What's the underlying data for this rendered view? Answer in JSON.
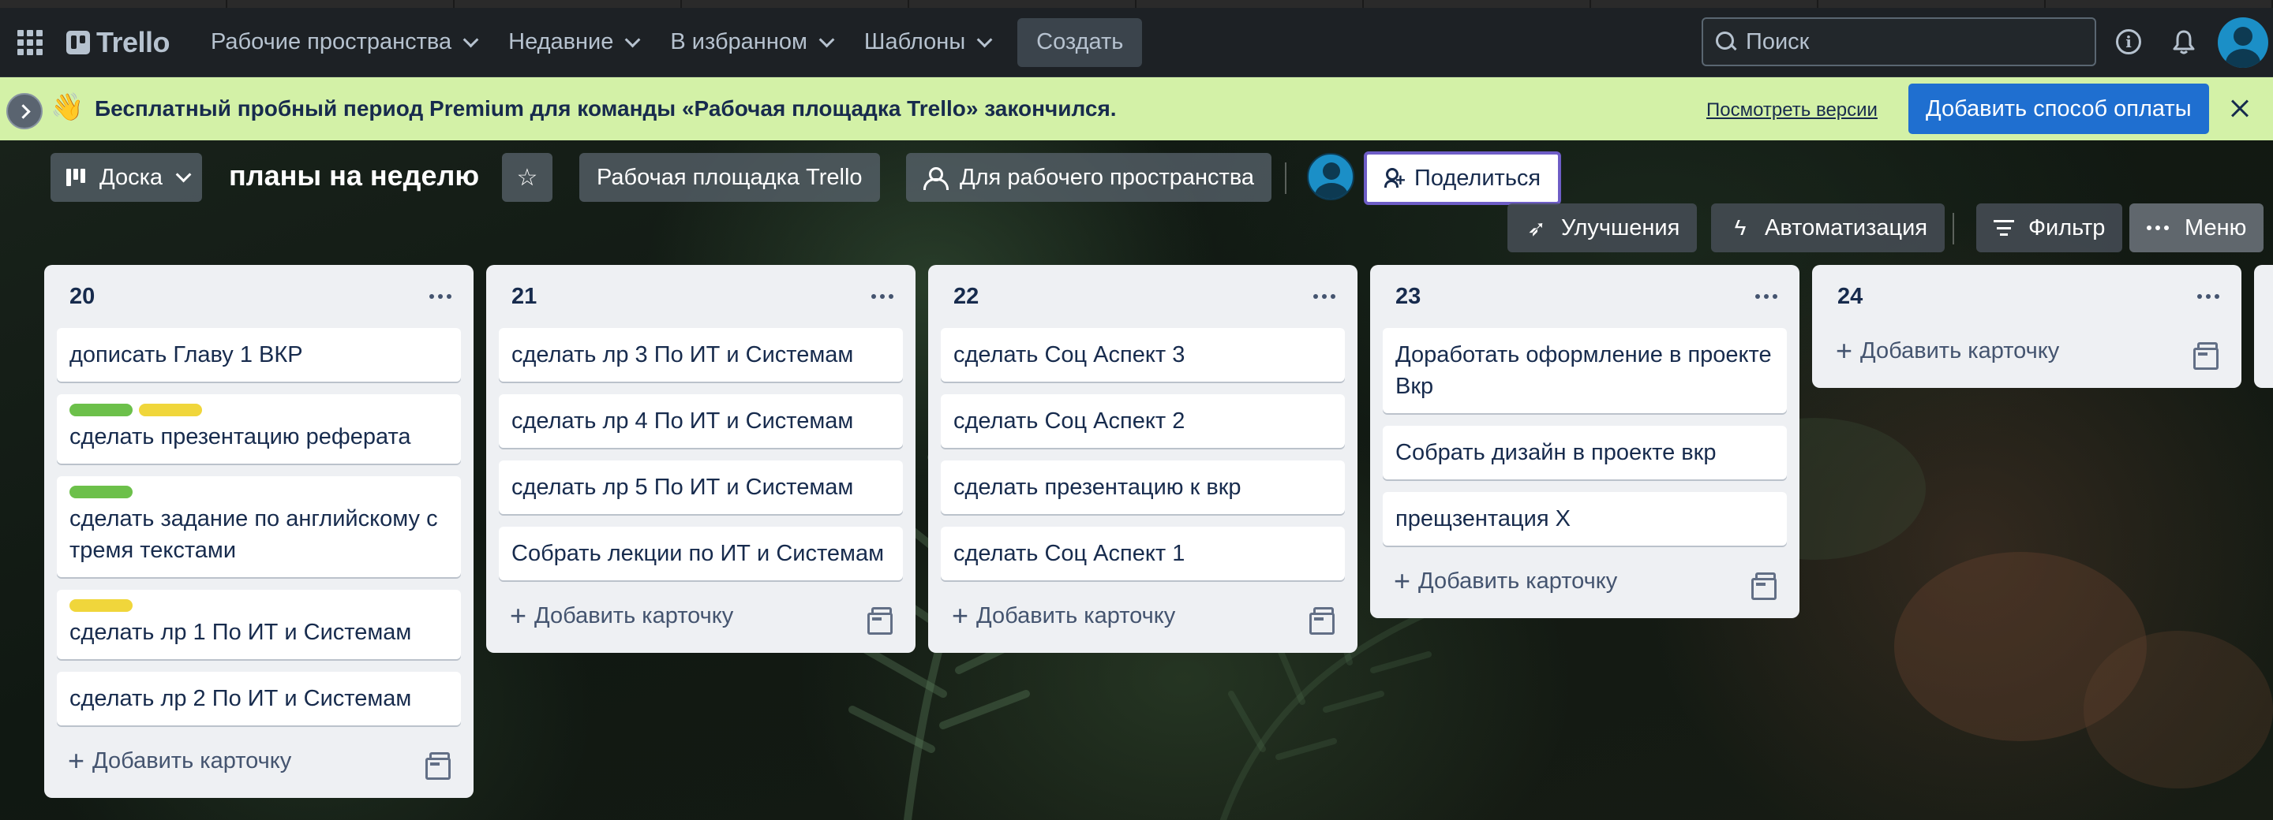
{
  "header": {
    "logo_text": "Trello",
    "nav": [
      {
        "label": "Рабочие пространства"
      },
      {
        "label": "Недавние"
      },
      {
        "label": "В избранном"
      },
      {
        "label": "Шаблоны"
      }
    ],
    "create_label": "Создать",
    "search_placeholder": "Поиск",
    "icons": [
      "apps-icon",
      "info-icon",
      "bell-icon",
      "avatar"
    ]
  },
  "banner": {
    "emoji": "👋",
    "text": "Бесплатный пробный период Premium для команды «Рабочая площадка Trello» закончился.",
    "link": "Посмотреть версии",
    "pay_button": "Добавить способ оплаты",
    "background": "#d3f1a7",
    "accent": "#1f6fd0"
  },
  "board": {
    "view_label": "Доска",
    "title": "планы на неделю",
    "workspace_label": "Рабочая площадка Trello",
    "visibility_label": "Для рабочего пространства",
    "share_label": "Поделиться",
    "upgrades_label": "Улучшения",
    "automation_label": "Автоматизация",
    "filter_label": "Фильтр",
    "menu_label": "Меню"
  },
  "add_card_label": "Добавить карточку",
  "label_colors": {
    "green": "#6cc04a",
    "yellow": "#f0d63b"
  },
  "lists": [
    {
      "title": "20",
      "cards": [
        {
          "text": "дописать Главу 1 ВКР",
          "labels": []
        },
        {
          "text": "сделать презентацию реферата",
          "labels": [
            "green",
            "yellow"
          ]
        },
        {
          "text": "сделать задание по английскому с тремя текстами",
          "labels": [
            "green"
          ]
        },
        {
          "text": "сделать лр 1 По ИТ и Системам",
          "labels": [
            "yellow"
          ]
        },
        {
          "text": "сделать лр 2 По ИТ и Системам",
          "labels": []
        }
      ]
    },
    {
      "title": "21",
      "cards": [
        {
          "text": "сделать лр 3 По ИТ и Системам",
          "labels": []
        },
        {
          "text": "сделать лр 4 По ИТ и Системам",
          "labels": []
        },
        {
          "text": "сделать лр 5 По ИТ и Системам",
          "labels": []
        },
        {
          "text": "Собрать лекции по ИТ и Системам",
          "labels": []
        }
      ]
    },
    {
      "title": "22",
      "cards": [
        {
          "text": "сделать Соц Аспект 3",
          "labels": []
        },
        {
          "text": "сделать Соц Аспект 2",
          "labels": []
        },
        {
          "text": "сделать презентацию к вкр",
          "labels": []
        },
        {
          "text": "сделать Соц Аспект 1",
          "labels": []
        }
      ]
    },
    {
      "title": "23",
      "cards": [
        {
          "text": "Доработать оформление в проекте Вкр",
          "labels": []
        },
        {
          "text": "Собрать дизайн в проекте вкр",
          "labels": []
        },
        {
          "text": "прещзентация Х",
          "labels": []
        }
      ]
    },
    {
      "title": "24",
      "cards": []
    }
  ]
}
